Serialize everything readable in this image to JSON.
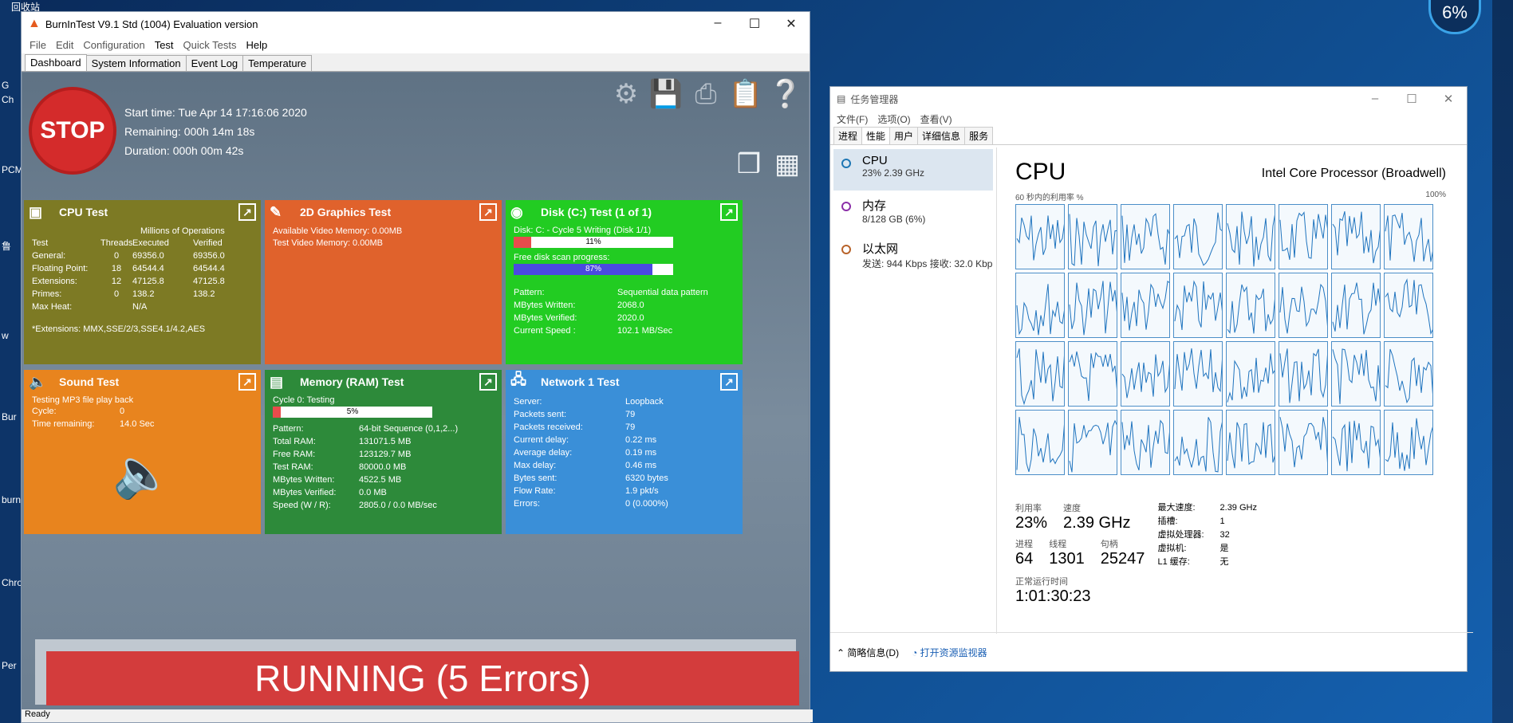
{
  "desktop": {
    "top_label": "回收站",
    "left_labels": [
      "G",
      "Ch",
      "PCM",
      "鲁",
      "w",
      "Bur",
      "burn",
      "Chro",
      "Per"
    ],
    "cpu_gauge": "6%"
  },
  "burnin": {
    "title": "BurnInTest V9.1 Std (1004) Evaluation version",
    "menu": [
      "File",
      "Edit",
      "Configuration",
      "Test",
      "Quick Tests",
      "Help"
    ],
    "tabs": [
      "Dashboard",
      "System Information",
      "Event Log",
      "Temperature"
    ],
    "stop_label": "STOP",
    "start_time": "Start time: Tue Apr 14 17:16:06 2020",
    "remaining": "Remaining: 000h 14m 18s",
    "duration": "Duration: 000h 00m 42s",
    "cpu": {
      "title": "CPU Test",
      "header_mops": "Millions of Operations",
      "col_test": "Test",
      "col_threads": "Threads",
      "col_executed": "Executed",
      "col_verified": "Verified",
      "rows": [
        {
          "name": "General:",
          "threads": "0",
          "executed": "69356.0",
          "verified": "69356.0"
        },
        {
          "name": "Floating Point:",
          "threads": "18",
          "executed": "64544.4",
          "verified": "64544.4"
        },
        {
          "name": "Extensions:",
          "threads": "12",
          "executed": "47125.8",
          "verified": "47125.8"
        },
        {
          "name": "Primes:",
          "threads": "0",
          "executed": "138.2",
          "verified": "138.2"
        },
        {
          "name": "Max Heat:",
          "threads": "",
          "executed": "N/A",
          "verified": ""
        }
      ],
      "footnote": "*Extensions: MMX,SSE/2/3,SSE4.1/4.2,AES"
    },
    "graphics": {
      "title": "2D Graphics Test",
      "line1": "Available Video Memory: 0.00MB",
      "line2": "Test Video Memory: 0.00MB"
    },
    "disk": {
      "title": "Disk (C:) Test (1 of 1)",
      "cycle_label": "Disk: C: - Cycle 5 Writing (Disk 1/1)",
      "cycle_pct": "11%",
      "cycle_value": 0.11,
      "scan_label": "Free disk scan progress:",
      "scan_pct": "87%",
      "scan_value": 0.87,
      "rows": [
        {
          "k": "Pattern:",
          "v": "Sequential data pattern"
        },
        {
          "k": "MBytes Written:",
          "v": "2068.0"
        },
        {
          "k": "MBytes Verified:",
          "v": "2020.0"
        },
        {
          "k": "Current Speed :",
          "v": "102.1 MB/Sec"
        }
      ]
    },
    "sound": {
      "title": "Sound Test",
      "line1": "Testing MP3 file play back",
      "rows": [
        {
          "k": "Cycle:",
          "v": "0"
        },
        {
          "k": "Time remaining:",
          "v": "14.0 Sec"
        }
      ]
    },
    "memory": {
      "title": "Memory (RAM) Test",
      "cycle_label": "Cycle 0: Testing",
      "cycle_pct": "5%",
      "cycle_value": 0.05,
      "rows": [
        {
          "k": "Pattern:",
          "v": "64-bit Sequence (0,1,2...)"
        },
        {
          "k": "Total RAM:",
          "v": "131071.5 MB"
        },
        {
          "k": "Free RAM:",
          "v": "123129.7 MB"
        },
        {
          "k": "Test RAM:",
          "v": "80000.0 MB"
        },
        {
          "k": "MBytes Written:",
          "v": "4522.5 MB"
        },
        {
          "k": "MBytes Verified:",
          "v": "0.0 MB"
        },
        {
          "k": "Speed (W / R):",
          "v": "2805.0 / 0.0  MB/sec"
        }
      ]
    },
    "network": {
      "title": "Network 1 Test",
      "rows": [
        {
          "k": "Server:",
          "v": "Loopback"
        },
        {
          "k": "Packets sent:",
          "v": "79"
        },
        {
          "k": "Packets received:",
          "v": "79"
        },
        {
          "k": "Current delay:",
          "v": "0.22 ms"
        },
        {
          "k": "Average delay:",
          "v": "0.19 ms"
        },
        {
          "k": "Max delay:",
          "v": "0.46 ms"
        },
        {
          "k": "Bytes sent:",
          "v": "6320 bytes"
        },
        {
          "k": "Flow Rate:",
          "v": "1.9 pkt/s"
        },
        {
          "k": "Errors:",
          "v": "0 (0.000%)"
        }
      ]
    },
    "status_banner": "RUNNING (5 Errors)",
    "statusbar": "Ready"
  },
  "taskmgr": {
    "title": "任务管理器",
    "menu": [
      "文件(F)",
      "选项(O)",
      "查看(V)"
    ],
    "tabs": [
      "进程",
      "性能",
      "用户",
      "详细信息",
      "服务"
    ],
    "side": [
      {
        "name": "CPU",
        "sub": "23%  2.39 GHz",
        "color": "#1f77b4"
      },
      {
        "name": "内存",
        "sub": "8/128 GB (6%)",
        "color": "#8b2fa8"
      },
      {
        "name": "以太网",
        "sub": "发送: 944 Kbps  接收: 32.0 Kbp",
        "color": "#b8632a"
      }
    ],
    "main_title": "CPU",
    "processor": "Intel Core Processor (Broadwell)",
    "axis_left": "60 秒内的利用率 %",
    "axis_right": "100%",
    "stats": {
      "util_label": "利用率",
      "util": "23%",
      "speed_label": "速度",
      "speed": "2.39 GHz",
      "proc_label": "进程",
      "proc": "64",
      "threads_label": "线程",
      "threads": "1301",
      "handles_label": "句柄",
      "handles": "25247",
      "uptime_label": "正常运行时间",
      "uptime": "1:01:30:23",
      "right": [
        {
          "k": "最大速度:",
          "v": "2.39 GHz"
        },
        {
          "k": "插槽:",
          "v": "1"
        },
        {
          "k": "虚拟处理器:",
          "v": "32"
        },
        {
          "k": "虚拟机:",
          "v": "是"
        },
        {
          "k": "L1 缓存:",
          "v": "无"
        }
      ]
    },
    "footer": {
      "brief": "简略信息(D)",
      "resmon": "打开资源监视器"
    }
  }
}
